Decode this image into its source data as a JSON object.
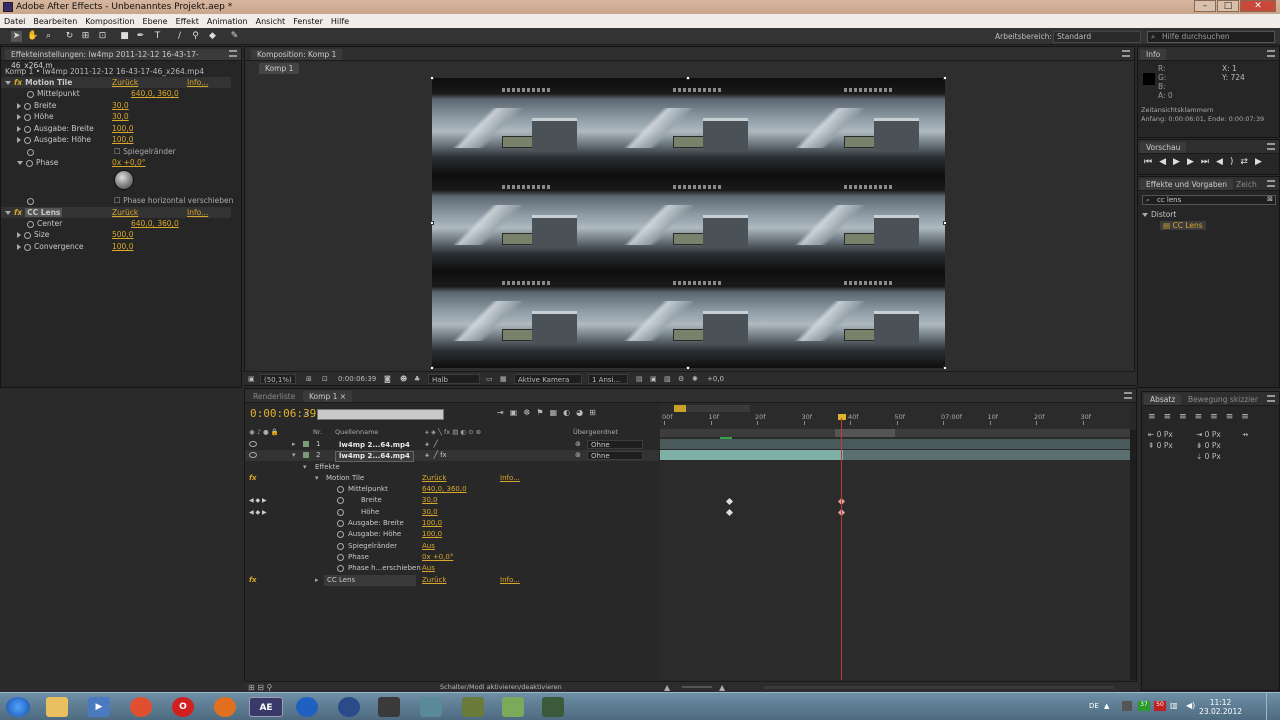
{
  "title_bar": {
    "title": "Adobe After Effects - Unbenanntes Projekt.aep *",
    "min": "–",
    "max": "□",
    "close": "✕"
  },
  "menu": [
    "Datei",
    "Bearbeiten",
    "Komposition",
    "Ebene",
    "Effekt",
    "Animation",
    "Ansicht",
    "Fenster",
    "Hilfe"
  ],
  "toolbar": {
    "workspace_label": "Arbeitsbereich:",
    "workspace_value": "Standard",
    "help_placeholder": "Hilfe durchsuchen"
  },
  "effect_controls": {
    "tab": "Effekteinstellungen: lw4mp 2011-12-12 16-43-17-46_x264.m",
    "header": "Komp 1 • lw4mp 2011-12-12 16-43-17-46_x264.mp4",
    "motion_tile": {
      "name": "Motion Tile",
      "reset": "Zurück",
      "info": "Info...",
      "props": [
        {
          "label": "Mittelpunkt",
          "value": "640,0, 360,0"
        },
        {
          "label": "Breite",
          "value": "30,0"
        },
        {
          "label": "Höhe",
          "value": "30,0"
        },
        {
          "label": "Ausgabe: Breite",
          "value": "100,0"
        },
        {
          "label": "Ausgabe: Höhe",
          "value": "100,0"
        }
      ],
      "spiegel": "Spiegelränder",
      "phase_label": "Phase",
      "phase_value": "0x +0,0°",
      "phase_shift": "Phase horizontal verschieben"
    },
    "cc_lens": {
      "name": "CC Lens",
      "reset": "Zurück",
      "info": "Info...",
      "props": [
        {
          "label": "Center",
          "value": "640,0, 360,0"
        },
        {
          "label": "Size",
          "value": "500,0"
        },
        {
          "label": "Convergence",
          "value": "100,0"
        }
      ]
    }
  },
  "composition": {
    "tab": "Komposition: Komp 1",
    "sub_tab": "Komp 1",
    "zoom": "(50,1%)",
    "timecode": "0:00:06:39",
    "resolution": "Halb",
    "camera": "Aktive Kamera",
    "views": "1 Ansi...",
    "exposure": "+0,0"
  },
  "timeline": {
    "tab_render": "Renderliste",
    "tab_comp": "Komp 1",
    "time": "0:00:06:39",
    "col_nr": "Nr.",
    "col_source": "Quellenname",
    "col_parent": "Übergeordnet",
    "layers": [
      {
        "num": "1",
        "name": "lw4mp 2...64.mp4",
        "parent": "Ohne"
      },
      {
        "num": "2",
        "name": "lw4mp 2...64.mp4",
        "parent": "Ohne"
      }
    ],
    "effects_label": "Effekte",
    "motion_tile": {
      "name": "Motion Tile",
      "reset": "Zurück",
      "info": "Info..."
    },
    "props": [
      {
        "label": "Mittelpunkt",
        "value": "640,0, 360,0"
      },
      {
        "label": "Breite",
        "value": "30,0"
      },
      {
        "label": "Höhe",
        "value": "30,0"
      },
      {
        "label": "Ausgabe: Breite",
        "value": "100,0"
      },
      {
        "label": "Ausgabe: Höhe",
        "value": "100,0"
      },
      {
        "label": "Spiegelränder",
        "value": "Aus"
      },
      {
        "label": "Phase",
        "value": "0x +0,0°"
      },
      {
        "label": "Phase h...erschieben",
        "value": "Aus"
      }
    ],
    "cc_lens": {
      "name": "CC Lens",
      "reset": "Zurück",
      "info": "Info..."
    },
    "ruler": [
      "00f",
      "10f",
      "20f",
      "30f",
      "40f",
      "50f",
      "07:00f",
      "10f",
      "20f",
      "30f"
    ],
    "footer": "Schalter/Modi aktivieren/deaktivieren"
  },
  "info_panel": {
    "tab": "Info",
    "r": "R:",
    "g": "G:",
    "b": "B:",
    "a": "A: 0",
    "x": "X: 1",
    "y": "Y: 724",
    "line1": "Zeitansichtsklammern",
    "line2": "Anfang: 0:00:06:01, Ende: 0:00:07:39"
  },
  "preview_panel": {
    "tab": "Vorschau"
  },
  "effects_presets": {
    "tab": "Effekte und Vorgaben",
    "tab2": "Zeich",
    "search": "cc lens",
    "category": "Distort",
    "item": "CC Lens"
  },
  "paragraph_panel": {
    "tab": "Absatz",
    "tab2": "Bewegung skizzier",
    "values": [
      "0 Px",
      "0 Px",
      "0 Px",
      "0 Px",
      "0 Px"
    ]
  },
  "taskbar": {
    "lang": "DE",
    "time": "11:12",
    "date": "23.02.2012",
    "tray1": "37",
    "tray2": "50",
    "ae_label": "AE"
  }
}
